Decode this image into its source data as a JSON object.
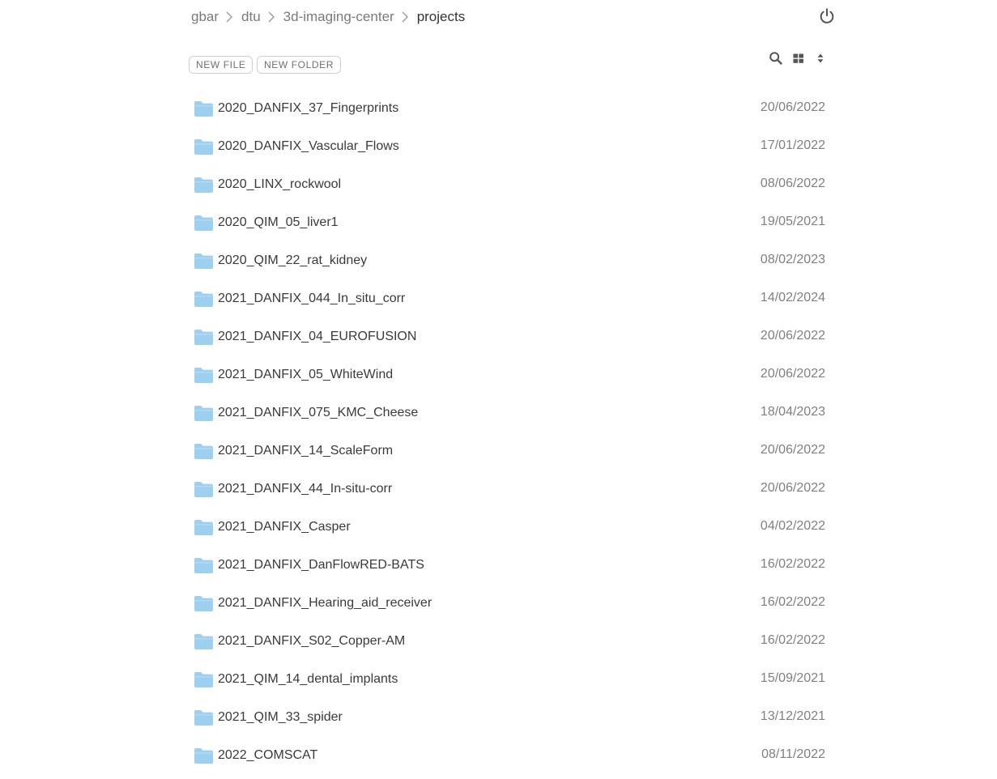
{
  "breadcrumb": {
    "items": [
      "gbar",
      "dtu",
      "3d-imaging-center"
    ],
    "current": "projects"
  },
  "toolbar": {
    "new_file_label": "NEW FILE",
    "new_folder_label": "NEW FOLDER"
  },
  "icons": {
    "power": "power-icon",
    "search": "search-icon",
    "grid": "grid-view-icon",
    "sort": "sort-icon",
    "folder": "folder-icon"
  },
  "colors": {
    "folder": "#9dd0ee",
    "muted": "#808080",
    "text": "#3a3a3a"
  },
  "files": [
    {
      "name": "2020_DANFIX_37_Fingerprints",
      "date": "20/06/2022"
    },
    {
      "name": "2020_DANFIX_Vascular_Flows",
      "date": "17/01/2022"
    },
    {
      "name": "2020_LINX_rockwool",
      "date": "08/06/2022"
    },
    {
      "name": "2020_QIM_05_liver1",
      "date": "19/05/2021"
    },
    {
      "name": "2020_QIM_22_rat_kidney",
      "date": "08/02/2023"
    },
    {
      "name": "2021_DANFIX_044_In_situ_corr",
      "date": "14/02/2024"
    },
    {
      "name": "2021_DANFIX_04_EUROFUSION",
      "date": "20/06/2022"
    },
    {
      "name": "2021_DANFIX_05_WhiteWind",
      "date": "20/06/2022"
    },
    {
      "name": "2021_DANFIX_075_KMC_Cheese",
      "date": "18/04/2023"
    },
    {
      "name": "2021_DANFIX_14_ScaleForm",
      "date": "20/06/2022"
    },
    {
      "name": "2021_DANFIX_44_In-situ-corr",
      "date": "20/06/2022"
    },
    {
      "name": "2021_DANFIX_Casper",
      "date": "04/02/2022"
    },
    {
      "name": "2021_DANFIX_DanFlowRED-BATS",
      "date": "16/02/2022"
    },
    {
      "name": "2021_DANFIX_Hearing_aid_receiver",
      "date": "16/02/2022"
    },
    {
      "name": "2021_DANFIX_S02_Copper-AM",
      "date": "16/02/2022"
    },
    {
      "name": "2021_QIM_14_dental_implants",
      "date": "15/09/2021"
    },
    {
      "name": "2021_QIM_33_spider",
      "date": "13/12/2021"
    },
    {
      "name": "2022_COMSCAT",
      "date": "08/11/2022"
    }
  ]
}
